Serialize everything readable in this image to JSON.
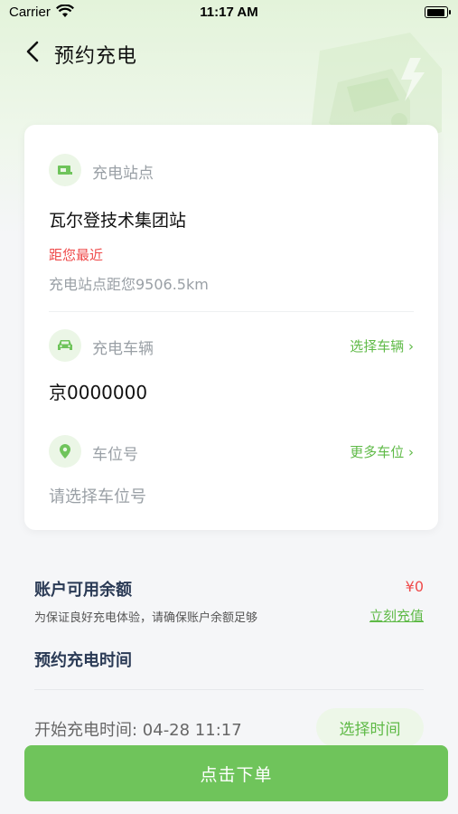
{
  "status_bar": {
    "carrier": "Carrier",
    "time": "11:17 AM"
  },
  "nav": {
    "title": "预约充电"
  },
  "card": {
    "station": {
      "label": "充电站点",
      "name": "瓦尔登技术集团站",
      "nearest_tag": "距您最近",
      "distance": "充电站点距您9506.5km"
    },
    "vehicle": {
      "label": "充电车辆",
      "link": "选择车辆",
      "plate": "京0000000"
    },
    "parking": {
      "label": "车位号",
      "link": "更多车位",
      "placeholder": "请选择车位号"
    }
  },
  "balance": {
    "title": "账户可用余额",
    "amount": "¥0",
    "hint": "为保证良好充电体验，请确保账户余额足够",
    "recharge_link": "立刻充值"
  },
  "reservation": {
    "title": "预约充电时间",
    "start_time": "开始充电时间: 04-28 11:17",
    "select_button": "选择时间"
  },
  "submit_button": "点击下单",
  "colors": {
    "accent": "#6fc45b",
    "link": "#5fba47",
    "warning": "#ef4b4b"
  }
}
